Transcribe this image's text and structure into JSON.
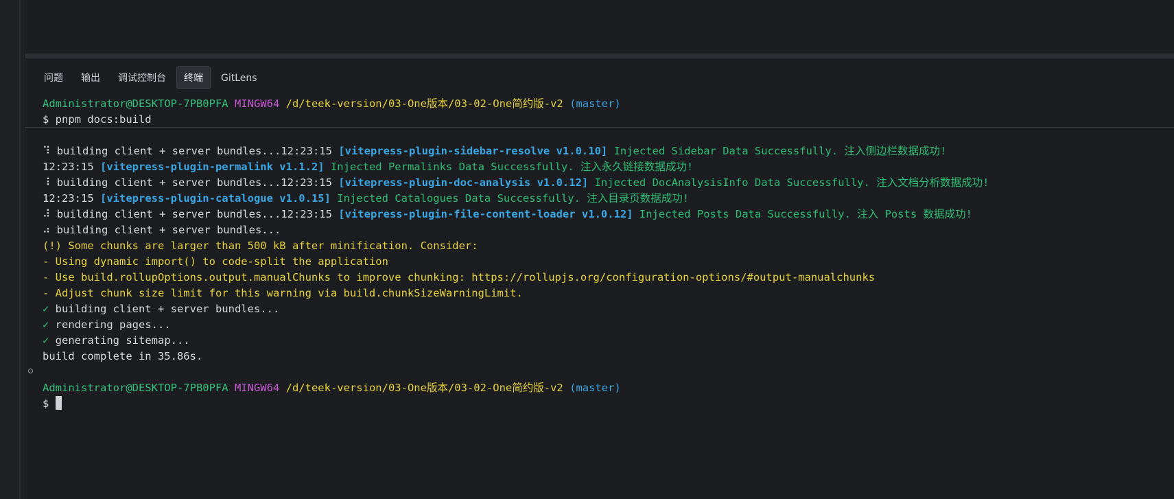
{
  "panel": {
    "tabs": [
      {
        "label": "问题"
      },
      {
        "label": "输出"
      },
      {
        "label": "调试控制台"
      },
      {
        "label": "终端",
        "active": true
      },
      {
        "label": "GitLens"
      }
    ]
  },
  "terminal": {
    "prompt1": {
      "user": "Administrator@DESKTOP-7PB0PFA",
      "shell": "MINGW64",
      "path": "/d/teek-version/03-One版本/03-02-One简约版-v2",
      "branch": "(master)"
    },
    "command": "$ pnpm docs:build",
    "log": [
      {
        "spinner": "⠹",
        "prefix": " building client + server bundles...12:23:15 ",
        "tag": "[vitepress-plugin-sidebar-resolve v1.0.10]",
        "msg": " Injected Sidebar Data Successfully. 注入侧边栏数据成功!"
      },
      {
        "spinner": "",
        "prefix": "12:23:15 ",
        "tag": "[vitepress-plugin-permalink v1.1.2]",
        "msg": " Injected Permalinks Data Successfully. 注入永久链接数据成功!"
      },
      {
        "spinner": "⠸",
        "prefix": " building client + server bundles...12:23:15 ",
        "tag": "[vitepress-plugin-doc-analysis v1.0.12]",
        "msg": " Injected DocAnalysisInfo Data Successfully. 注入文档分析数据成功!"
      },
      {
        "spinner": "",
        "prefix": "12:23:15 ",
        "tag": "[vitepress-plugin-catalogue v1.0.15]",
        "msg": " Injected Catalogues Data Successfully. 注入目录页数据成功!"
      },
      {
        "spinner": "⠼",
        "prefix": " building client + server bundles...12:23:15 ",
        "tag": "[vitepress-plugin-file-content-loader v1.0.12]",
        "msg": " Injected Posts Data Successfully. 注入 Posts 数据成功!"
      }
    ],
    "bundling": "⠴ building client + server bundles...",
    "warnings": [
      "(!) Some chunks are larger than 500 kB after minification. Consider:",
      "- Using dynamic import() to code-split the application",
      "- Use build.rollupOptions.output.manualChunks to improve chunking: https://rollupjs.org/configuration-options/#output-manualchunks",
      "- Adjust chunk size limit for this warning via build.chunkSizeWarningLimit."
    ],
    "checks": [
      {
        "mark": "✓",
        "text": " building client + server bundles..."
      },
      {
        "mark": "✓",
        "text": " rendering pages..."
      },
      {
        "mark": "✓",
        "text": " generating sitemap..."
      }
    ],
    "complete": "build complete in 35.86s.",
    "prompt2": {
      "user": "Administrator@DESKTOP-7PB0PFA",
      "shell": "MINGW64",
      "path": "/d/teek-version/03-One版本/03-02-One简约版-v2",
      "branch": "(master)"
    },
    "input_prompt": "$ "
  }
}
